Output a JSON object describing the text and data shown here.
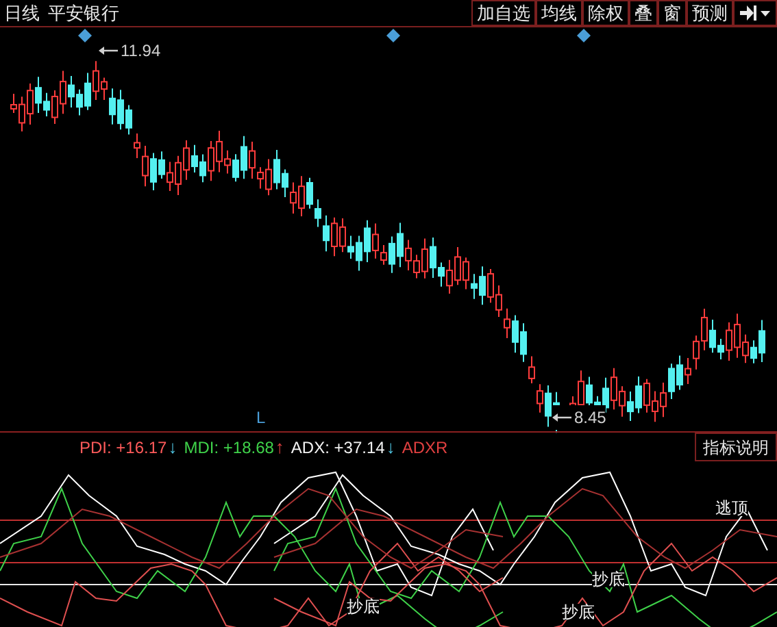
{
  "header": {
    "period": "日线",
    "stock": "平安银行"
  },
  "toolbar": [
    {
      "label": "加自选"
    },
    {
      "label": "均线"
    },
    {
      "label": "除权"
    },
    {
      "label": "叠"
    },
    {
      "label": "窗"
    },
    {
      "label": "预测"
    }
  ],
  "main_chart": {
    "high_label": "11.94",
    "low_label": "8.45",
    "marker": "L"
  },
  "indicator": {
    "values": [
      {
        "label": "PDI: +16.17",
        "color": "#ff5a5a",
        "arrow": {
          "glyph": "↓",
          "color": "#4fc3e0"
        }
      },
      {
        "label": "MDI: +18.68",
        "color": "#3fd24a",
        "arrow": {
          "glyph": "↑",
          "color": "#e04040"
        }
      },
      {
        "label": "ADX: +37.14",
        "color": "#f2f2f2",
        "arrow": {
          "glyph": "↓",
          "color": "#4fc3e0"
        }
      },
      {
        "label": "ADXR",
        "color": "#e04040"
      }
    ],
    "help_button": "指标说明",
    "signals": [
      {
        "label": "抄底"
      },
      {
        "label": "抄底"
      },
      {
        "label": "抄底"
      },
      {
        "label": "逃顶"
      }
    ]
  }
}
